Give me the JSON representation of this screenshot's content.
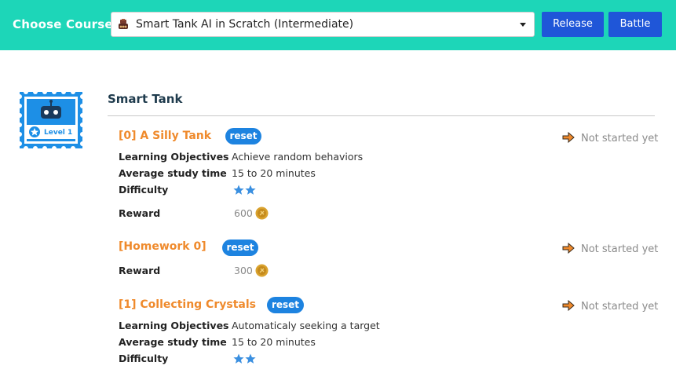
{
  "header": {
    "choose_label": "Choose Course",
    "course_selected": "Smart Tank AI in Scratch (Intermediate)",
    "release_label": "Release",
    "battle_label": "Battle"
  },
  "badge": {
    "level_label": "Level 1"
  },
  "section": {
    "title": "Smart Tank"
  },
  "lessons": [
    {
      "title": "[0] A Silly Tank",
      "reset_label": "reset",
      "status": "Not started yet",
      "objectives_label": "Learning Objectives",
      "objectives": "Achieve random behaviors",
      "study_time_label": "Average study time",
      "study_time": "15 to 20 minutes",
      "difficulty_label": "Difficulty",
      "difficulty_stars": 2,
      "reward_label": "Reward",
      "reward": "600"
    },
    {
      "title": "[Homework 0]",
      "reset_label": "reset",
      "status": "Not started yet",
      "reward_label": "Reward",
      "reward": "300"
    },
    {
      "title": "[1] Collecting Crystals",
      "reset_label": "reset",
      "status": "Not started yet",
      "objectives_label": "Learning Objectives",
      "objectives": "Automaticaly seeking a target",
      "study_time_label": "Average study time",
      "study_time": "15 to 20 minutes",
      "difficulty_label": "Difficulty",
      "difficulty_stars": 2
    }
  ],
  "colors": {
    "header_bg": "#1dd6b8",
    "button_blue": "#1f56d8",
    "reset_blue": "#1d83e0",
    "lesson_orange": "#ef8a2c",
    "star_blue": "#3a8fe0",
    "coin_gold": "#d9a22e"
  },
  "icons": {
    "course_icon": "tank-icon",
    "status_icon": "arrow-right-icon",
    "reward_icon": "coin-icon",
    "difficulty_icon": "star-icon"
  }
}
